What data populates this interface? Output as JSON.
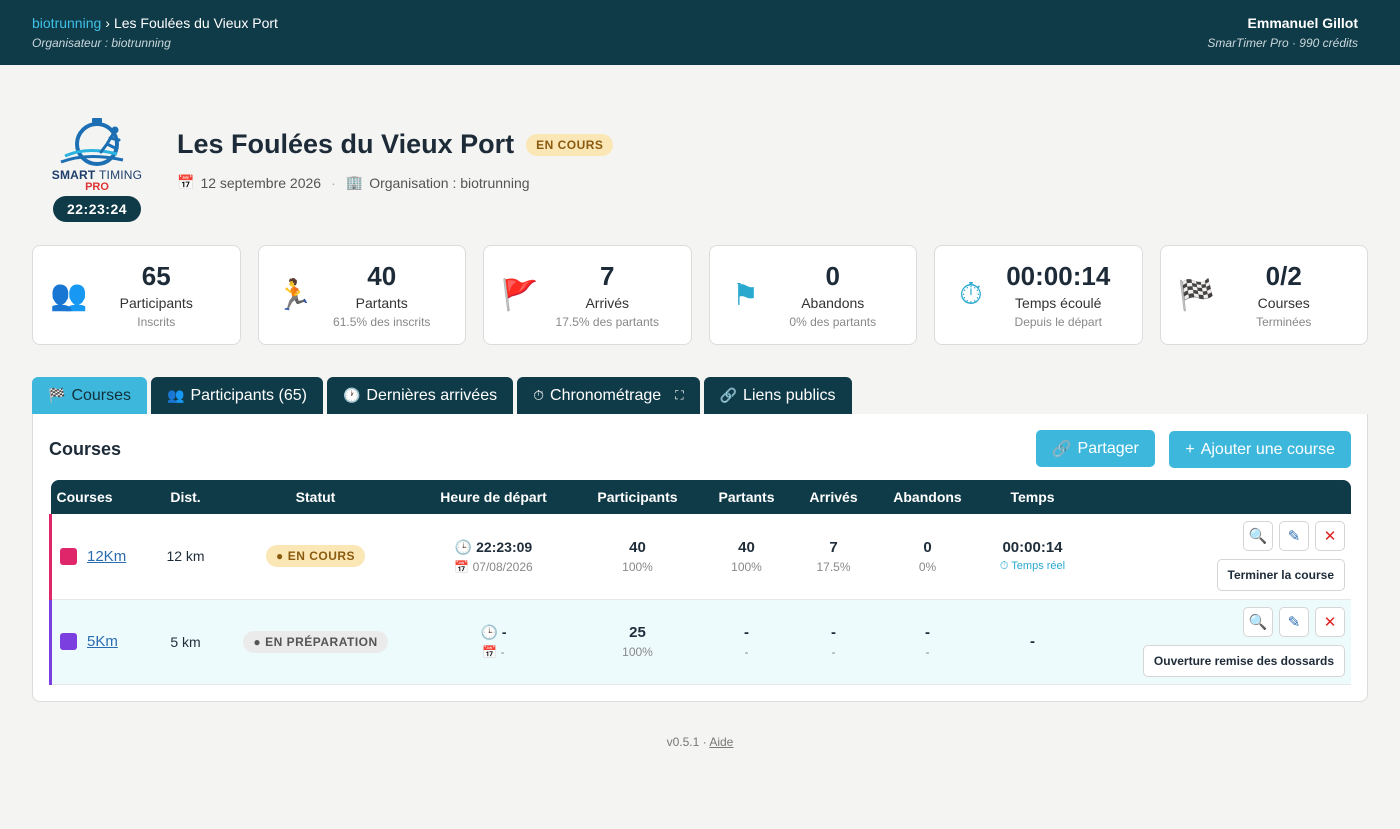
{
  "topbar": {
    "org_link": "biotrunning",
    "separator": "›",
    "event_name": "Les Foulées du Vieux Port",
    "organizer": "Organisateur : biotrunning",
    "user_name": "Emmanuel Gillot",
    "user_plan": "SmarTimer Pro · 990 crédits"
  },
  "logo": {
    "brand_bold": "SMART",
    "brand_thin": "TIMING",
    "pro": "PRO",
    "clock": "22:23:24"
  },
  "event": {
    "title": "Les Foulées du Vieux Port",
    "status": "EN COURS",
    "date_icon": "📅",
    "date": "12 septembre 2026",
    "org_icon": "🏢",
    "organisation": "Organisation : biotrunning"
  },
  "stats": [
    {
      "icon": "👥",
      "value": "65",
      "label": "Participants",
      "sub": "Inscrits"
    },
    {
      "icon": "🏃",
      "value": "40",
      "label": "Partants",
      "sub": "61.5% des inscrits"
    },
    {
      "icon": "🚩",
      "value": "7",
      "label": "Arrivés",
      "sub": "17.5% des partants"
    },
    {
      "icon": "⚑",
      "value": "0",
      "label": "Abandons",
      "sub": "0% des partants"
    },
    {
      "icon": "⏱",
      "value": "00:00:14",
      "label": "Temps écoulé",
      "sub": "Depuis le départ"
    },
    {
      "icon": "🏁",
      "value": "0/2",
      "label": "Courses",
      "sub": "Terminées"
    }
  ],
  "tabs": [
    {
      "icon": "🏁",
      "label": "Courses"
    },
    {
      "icon": "👥",
      "label": "Participants (65)"
    },
    {
      "icon": "🕐",
      "label": "Dernières arrivées"
    },
    {
      "icon": "⏱",
      "label": "Chronométrage",
      "extra": "⛶"
    },
    {
      "icon": "🔗",
      "label": "Liens publics"
    }
  ],
  "panel": {
    "title": "Courses",
    "share_icon": "🔗",
    "share_label": "Partager",
    "add_icon": "+",
    "add_label": "Ajouter une course"
  },
  "table": {
    "headers": [
      "Courses",
      "Dist.",
      "Statut",
      "Heure de départ",
      "Participants",
      "Partants",
      "Arrivés",
      "Abandons",
      "Temps",
      ""
    ],
    "rows": [
      {
        "color": "#e0266a",
        "name": "12Km",
        "dist": "12 km",
        "status": "EN COURS",
        "status_dot": "●",
        "time_icon": "🕒",
        "start_time": "22:23:09",
        "date_icon": "📅",
        "start_date": "07/08/2026",
        "participants": "40",
        "participants_pct": "100%",
        "partants": "40",
        "partants_pct": "100%",
        "arrives": "7",
        "arrives_pct": "17.5%",
        "abandons": "0",
        "abandons_pct": "0%",
        "temps": "00:00:14",
        "temps_sub": "⏱ Temps réel",
        "action": "Terminer la course"
      },
      {
        "color": "#7b3fe0",
        "name": "5Km",
        "dist": "5 km",
        "status": "EN PRÉPARATION",
        "status_dot": "●",
        "time_icon": "🕒",
        "start_time": "-",
        "date_icon": "📅",
        "start_date": "-",
        "participants": "25",
        "participants_pct": "100%",
        "partants": "-",
        "partants_pct": "-",
        "arrives": "-",
        "arrives_pct": "-",
        "abandons": "-",
        "abandons_pct": "-",
        "temps": "-",
        "temps_sub": "",
        "action": "Ouverture remise des dossards"
      }
    ],
    "icons": {
      "view": "🔍",
      "edit": "✎",
      "delete": "✕"
    }
  },
  "footer": {
    "version": "v0.5.1 · ",
    "help": "Aide"
  }
}
